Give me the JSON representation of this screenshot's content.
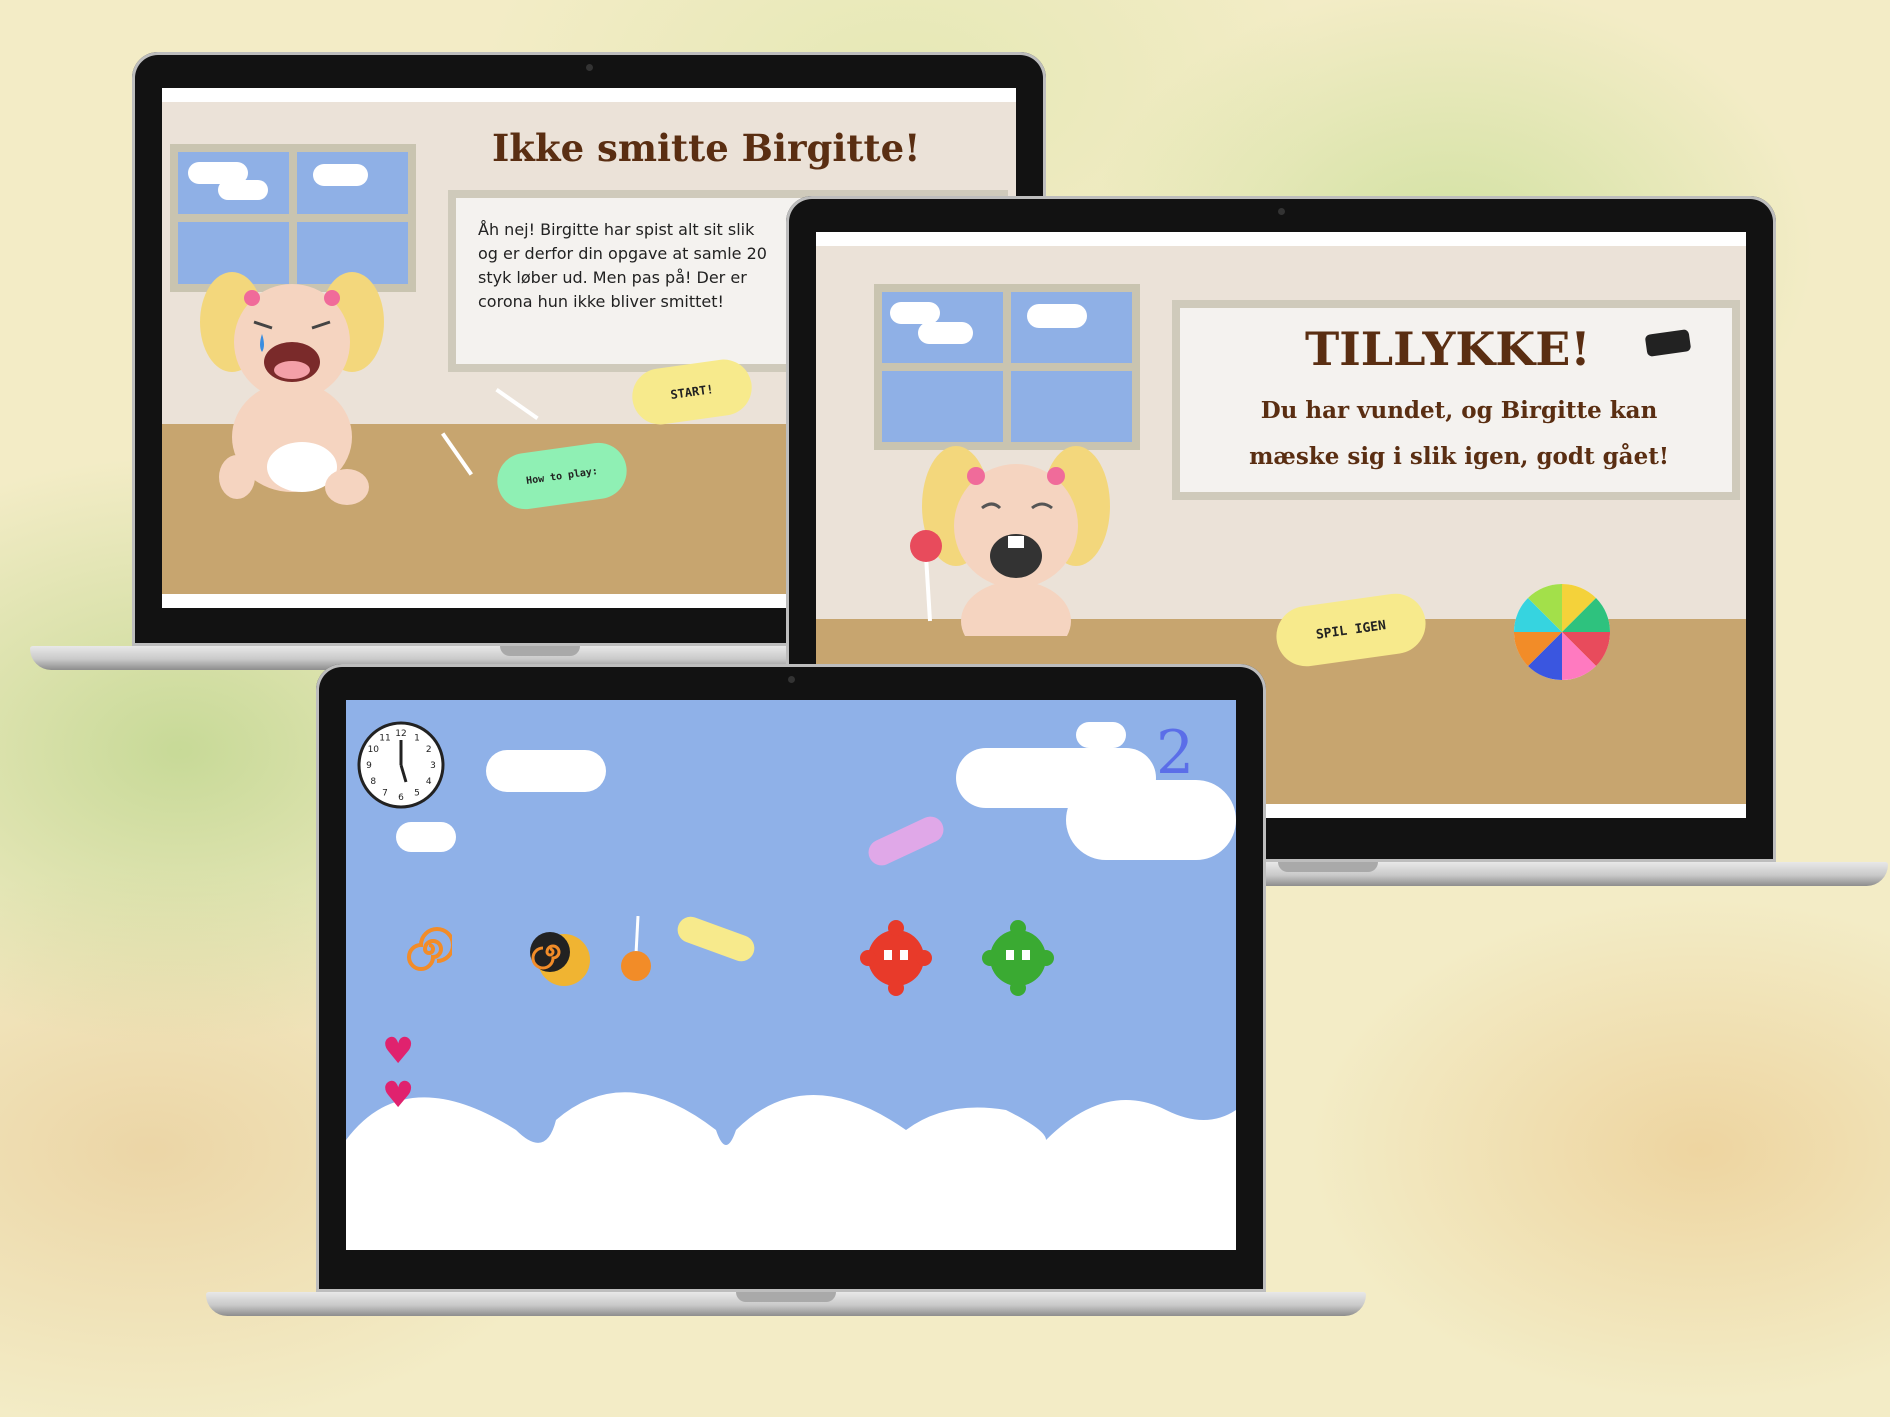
{
  "intro": {
    "title": "Ikke smitte Birgitte!",
    "description": "Åh nej! Birgitte har spist alt sit slik og er derfor din opgave at samle 20 styk løber ud. Men pas på! Der er corona hun ikke bliver smittet!",
    "start_label": "START!",
    "howto_label": "How to play:"
  },
  "win": {
    "title": "TILLYKKE!",
    "message": "Du har vundet, og Birgitte kan mæske sig i slik igen, godt gået!",
    "replay_label": "SPIL IGEN"
  },
  "game": {
    "score": "2",
    "lives": 2,
    "clock_numbers": [
      "12",
      "1",
      "2",
      "3",
      "4",
      "5",
      "6",
      "7",
      "8",
      "9",
      "10",
      "11"
    ]
  },
  "colors": {
    "title_brown": "#5a2e12",
    "sky_blue": "#8fb1e8",
    "floor_tan": "#c7a56f",
    "candy_yellow": "#f7ea8c",
    "candy_green": "#8ff0b4",
    "heart": "#e0226e",
    "score_blue": "#5b6ee8"
  }
}
